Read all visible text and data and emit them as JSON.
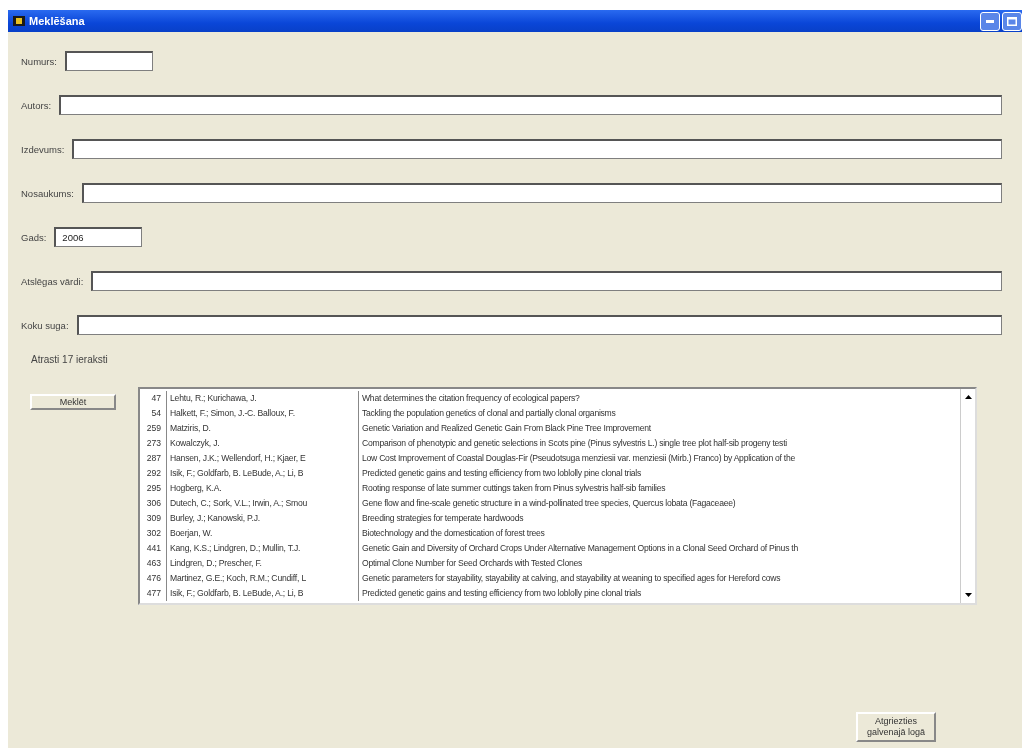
{
  "window": {
    "title": "Meklēšana"
  },
  "fields": [
    {
      "label": "Numurs:",
      "kind": "short"
    },
    {
      "label": "Autors:",
      "kind": "long"
    },
    {
      "label": "Izdevums:",
      "kind": "long"
    },
    {
      "label": "Nosaukums:",
      "kind": "long"
    },
    {
      "label": "Gads:",
      "value": "2006",
      "kind": "short"
    },
    {
      "label": "Atslēgas vārdi:",
      "kind": "long"
    },
    {
      "label": "Koku suga:",
      "kind": "long"
    }
  ],
  "result_count": "Atrasti 17 ieraksti",
  "search_button": "Meklēt",
  "results": [
    {
      "number": "47",
      "authors": "Lehtu, R.; Kurichawa, J.",
      "title": "What determines the citation frequency of ecological papers?"
    },
    {
      "number": "54",
      "authors": "Halkett, F.; Simon, J.-C. Balloux, F.",
      "title": "Tackling the population genetics of clonal and partially clonal organisms"
    },
    {
      "number": "259",
      "authors": "Matziris, D.",
      "title": "Genetic Variation and Realized Genetic Gain From Black Pine Tree Improvement"
    },
    {
      "number": "273",
      "authors": "Kowalczyk, J.",
      "title": "Comparison of phenotypic and genetic selections in Scots pine (Pinus sylvestris L.) single tree plot half-sib progeny testi"
    },
    {
      "number": "287",
      "authors": "Hansen, J.K.; Wellendorf, H.; Kjaer, E",
      "title": "Low Cost Improvement of Coastal Douglas-Fir (Pseudotsuga menziesii var. menziesii (Mirb.) Franco) by Application of the"
    },
    {
      "number": "292",
      "authors": "Isik, F.; Goldfarb, B. LeBude, A.; Li, B",
      "title": "Predicted genetic gains and testing efficiency from two loblolly pine clonal trials"
    },
    {
      "number": "295",
      "authors": "Hogberg, K.A.",
      "title": "Rooting response of late summer cuttings taken from Pinus sylvestris half-sib families"
    },
    {
      "number": "306",
      "authors": "Dutech, C.; Sork, V.L.; Irwin, A.; Smou",
      "title": "Gene flow and fine-scale genetic structure in a wind-pollinated tree species, Quercus lobata (Fagaceaee)"
    },
    {
      "number": "309",
      "authors": "Burley, J.; Kanowski, P.J.",
      "title": "Breeding strategies for temperate hardwoods"
    },
    {
      "number": "302",
      "authors": "Boerjan, W.",
      "title": "Biotechnology and the domestication of forest trees"
    },
    {
      "number": "441",
      "authors": "Kang, K.S.; Lindgren, D.; Mullin, T.J.",
      "title": "Genetic Gain and Diversity of Orchard Crops Under Alternative Management Options in a Clonal Seed Orchard of Pinus th"
    },
    {
      "number": "463",
      "authors": "Lindgren, D.; Prescher, F.",
      "title": "Optimal Clone Number for Seed Orchards with Tested Clones"
    },
    {
      "number": "476",
      "authors": "Martinez, G.E.; Koch, R.M.; Cundiff, L",
      "title": "Genetic parameters for stayability, stayability at calving, and stayability at weaning to specified ages for Hereford cows"
    },
    {
      "number": "477",
      "authors": "Isik, F.; Goldfarb, B. LeBude, A.; Li, B",
      "title": "Predicted genetic gains and testing efficiency from two loblolly pine clonal trials"
    }
  ],
  "return_button": "Atgriezties galvenajā logā"
}
